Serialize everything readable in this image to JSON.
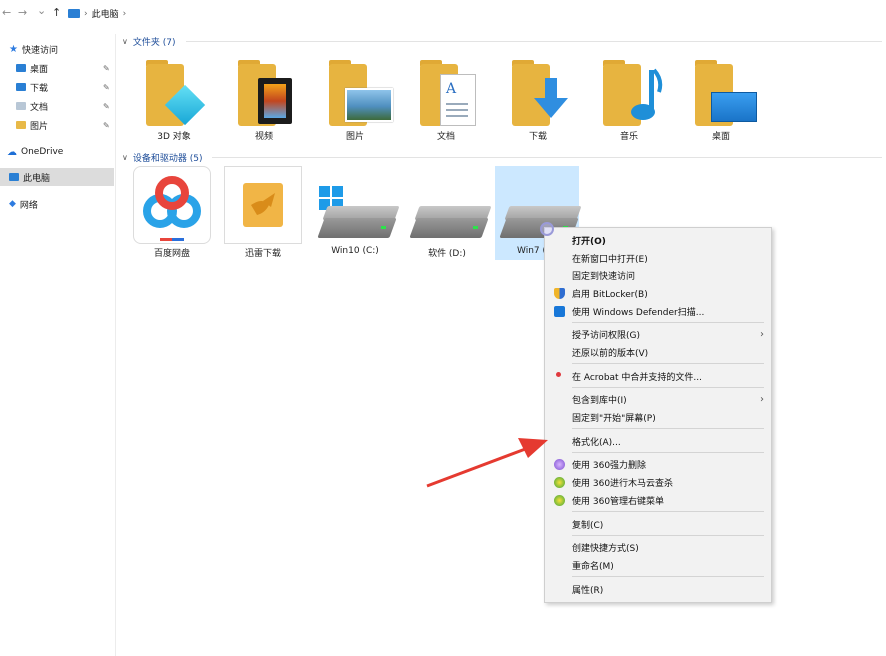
{
  "addressbar": {
    "back": "←",
    "forward": "→",
    "recent": "⌄",
    "up": "↑",
    "path_sep": "›",
    "path": "此电脑"
  },
  "sidebar": {
    "quick_access": "快速访问",
    "items": [
      {
        "label": "桌面",
        "pinned": true
      },
      {
        "label": "下载",
        "pinned": true
      },
      {
        "label": "文档",
        "pinned": true
      },
      {
        "label": "图片",
        "pinned": true
      }
    ],
    "onedrive": "OneDrive",
    "this_pc": "此电脑",
    "network": "网络",
    "pin_glyph": "📌"
  },
  "folders_group": {
    "title": "文件夹 (7)",
    "items": [
      {
        "label": "3D 对象",
        "icon": "cube-icon"
      },
      {
        "label": "视频",
        "icon": "film-icon"
      },
      {
        "label": "图片",
        "icon": "picture-icon"
      },
      {
        "label": "文档",
        "icon": "document-icon"
      },
      {
        "label": "下载",
        "icon": "download-arrow-icon"
      },
      {
        "label": "音乐",
        "icon": "music-note-icon"
      },
      {
        "label": "桌面",
        "icon": "desktop-icon"
      }
    ]
  },
  "devices_group": {
    "title": "设备和驱动器 (5)",
    "items": [
      {
        "label": "百度网盘"
      },
      {
        "label": "迅雷下载"
      },
      {
        "label": "Win10 (C:)"
      },
      {
        "label": "软件 (D:)"
      },
      {
        "label": "Win7 ("
      }
    ]
  },
  "context_menu": {
    "items": [
      {
        "label": "打开(O)",
        "bold": true
      },
      {
        "label": "在新窗口中打开(E)"
      },
      {
        "label": "固定到快速访问"
      },
      {
        "label": "启用 BitLocker(B)",
        "icon": "shield-icon"
      },
      {
        "label": "使用 Windows Defender扫描...",
        "icon": "defender-icon"
      },
      {
        "label": "授予访问权限(G)",
        "submenu": true
      },
      {
        "label": "还原以前的版本(V)"
      },
      {
        "label": "在 Acrobat 中合并支持的文件...",
        "icon": "acrobat-icon"
      },
      {
        "label": "包含到库中(I)",
        "submenu": true
      },
      {
        "label": "固定到\"开始\"屏幕(P)"
      },
      {
        "label": "格式化(A)..."
      },
      {
        "label": "使用 360强力删除",
        "icon": "360-delete-icon"
      },
      {
        "label": "使用 360进行木马云查杀",
        "icon": "360-scan-icon"
      },
      {
        "label": "使用 360管理右键菜单",
        "icon": "360-menu-icon"
      },
      {
        "label": "复制(C)"
      },
      {
        "label": "创建快捷方式(S)"
      },
      {
        "label": "重命名(M)"
      },
      {
        "label": "属性(R)"
      }
    ],
    "submenu_glyph": "›"
  },
  "colors": {
    "accent": "#1f4e9a",
    "selection": "#cce8ff",
    "arrow": "#e53a30"
  }
}
